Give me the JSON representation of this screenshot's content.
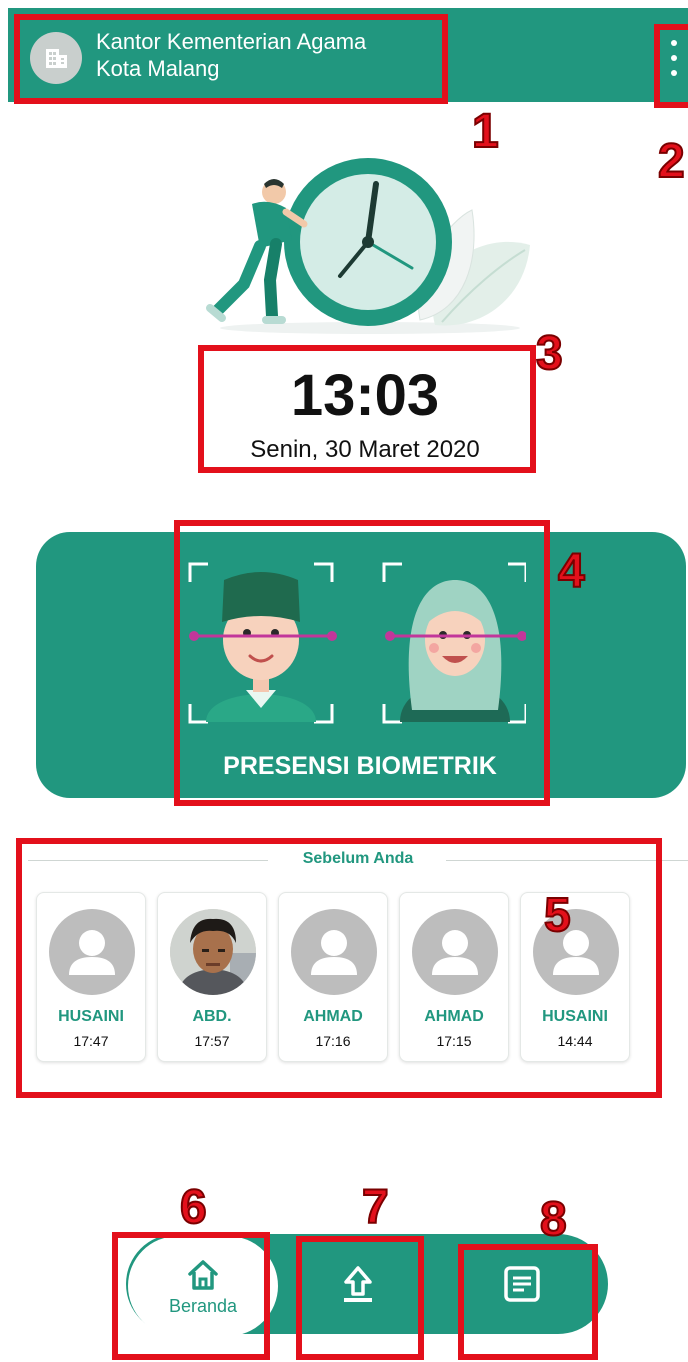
{
  "header": {
    "office_line1": "Kantor Kementerian Agama",
    "office_line2": "Kota Malang"
  },
  "clock": {
    "time": "13:03",
    "date": "Senin, 30 Maret 2020"
  },
  "biometric": {
    "label": "PRESENSI BIOMETRIK"
  },
  "recent": {
    "title": "Sebelum Anda",
    "people": [
      {
        "name": "HUSAINI",
        "time": "17:47",
        "photo": "placeholder"
      },
      {
        "name": "ABD.",
        "time": "17:57",
        "photo": "photo"
      },
      {
        "name": "AHMAD",
        "time": "17:16",
        "photo": "placeholder"
      },
      {
        "name": "AHMAD",
        "time": "17:15",
        "photo": "placeholder"
      },
      {
        "name": "HUSAINI",
        "time": "14:44",
        "photo": "placeholder"
      }
    ]
  },
  "nav": {
    "home_label": "Beranda",
    "upload_icon": "upload-icon",
    "history_icon": "document-icon"
  },
  "annotations": [
    "1",
    "2",
    "3",
    "4",
    "5",
    "6",
    "7",
    "8"
  ],
  "colors": {
    "primary": "#21977f",
    "annotation": "#e3101b"
  }
}
